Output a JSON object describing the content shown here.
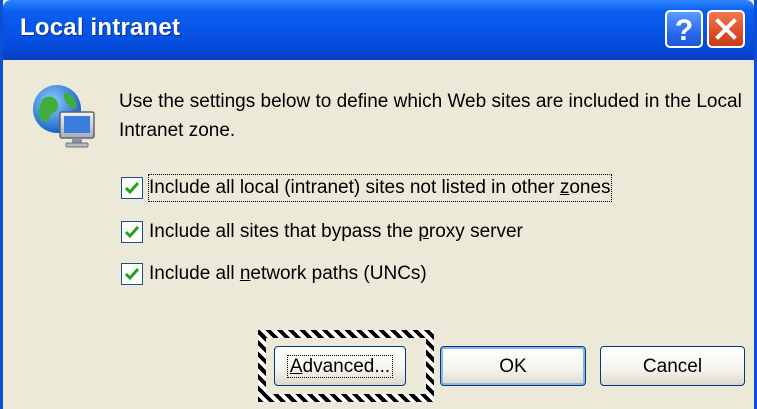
{
  "window": {
    "title": "Local intranet"
  },
  "titlebar_buttons": {
    "help_icon": "help-icon",
    "close_icon": "close-icon"
  },
  "icon": {
    "name": "intranet-zone-icon"
  },
  "description": "Use the settings below to define which Web sites are included in the Local Intranet zone.",
  "options": [
    {
      "pre": "Include all local (intranet) sites not listed in other ",
      "key": "z",
      "post": "ones",
      "checked": true
    },
    {
      "pre": "Include all sites that bypass the ",
      "key": "p",
      "post": "roxy server",
      "checked": true
    },
    {
      "pre": "Include all ",
      "key": "n",
      "post": "etwork paths (UNCs)",
      "checked": true
    }
  ],
  "buttons": {
    "advanced": {
      "key": "A",
      "rest": "dvanced..."
    },
    "ok": "OK",
    "cancel": "Cancel"
  },
  "colors": {
    "titlebar": "#0653e6",
    "window_bg": "#ece9d8",
    "button_border": "#003c74",
    "close_button": "#e0502a"
  }
}
